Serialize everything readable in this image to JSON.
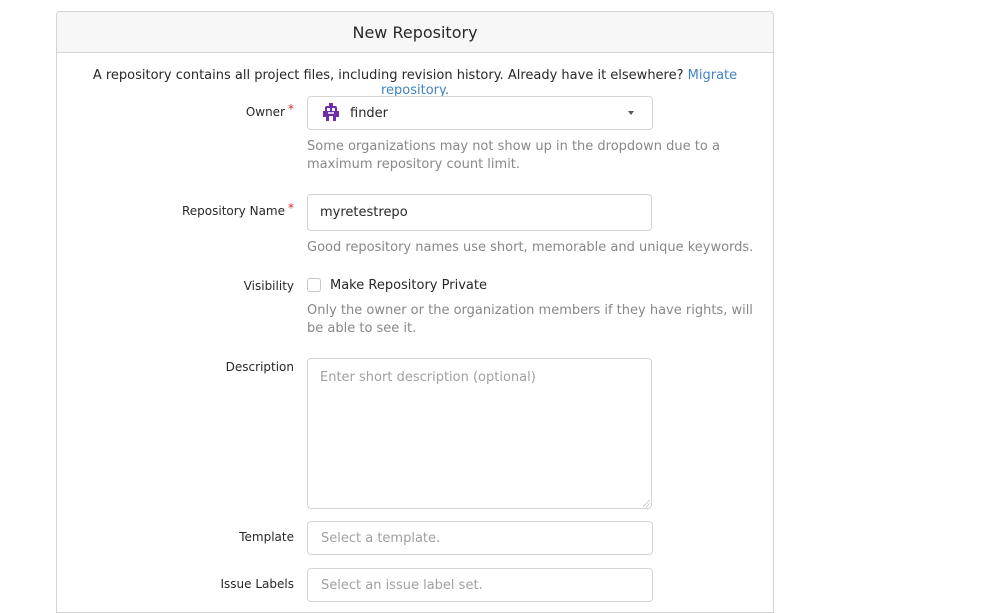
{
  "header": {
    "title": "New Repository"
  },
  "intro": {
    "text": "A repository contains all project files, including revision history. Already have it elsewhere?",
    "migrate_link": "Migrate repository."
  },
  "owner": {
    "label": "Owner",
    "required_mark": "*",
    "value": "finder",
    "help": "Some organizations may not show up in the dropdown due to a maximum repository count limit."
  },
  "repo_name": {
    "label": "Repository Name",
    "required_mark": "*",
    "value": "myretestrepo",
    "help": "Good repository names use short, memorable and unique keywords."
  },
  "visibility": {
    "label": "Visibility",
    "checkbox_label": "Make Repository Private",
    "checked": false,
    "help": "Only the owner or the organization members if they have rights, will be able to see it."
  },
  "description": {
    "label": "Description",
    "placeholder": "Enter short description (optional)"
  },
  "template": {
    "label": "Template",
    "placeholder": "Select a template."
  },
  "issue_labels": {
    "label": "Issue Labels",
    "placeholder": "Select an issue label set."
  },
  "colors": {
    "link": "#4183c4",
    "required": "#db2828",
    "help_text": "#888888",
    "avatar": "#6f2da8"
  },
  "icons": {
    "owner_avatar": "org-avatar-icon",
    "dropdown": "caret-down-icon"
  }
}
